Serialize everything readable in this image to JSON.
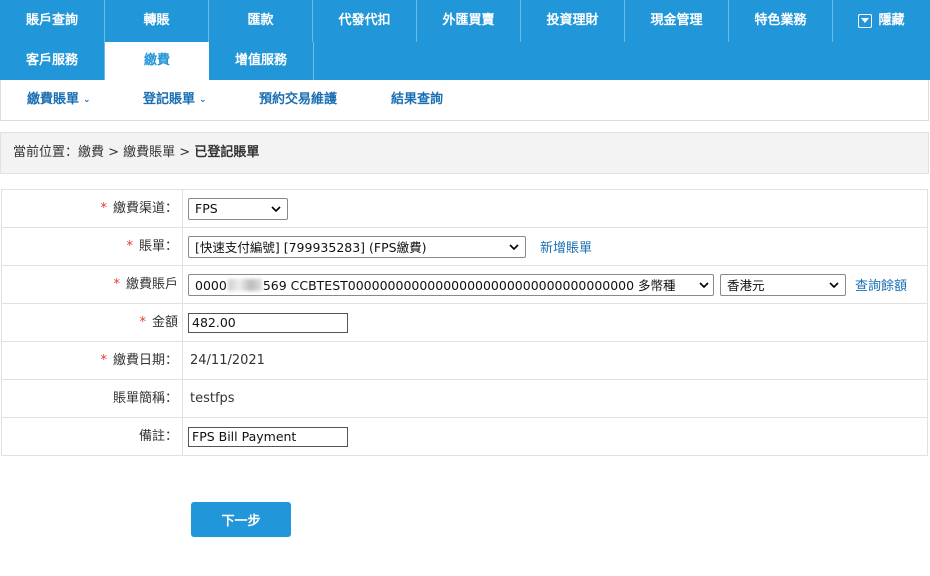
{
  "nav_primary": [
    "賬戶查詢",
    "轉賬",
    "匯款",
    "代發代扣",
    "外匯買賣",
    "投資理財",
    "現金管理",
    "特色業務"
  ],
  "nav_hide_label": "隱藏",
  "nav_secondary": [
    "客戶服務",
    "繳費",
    "增值服務"
  ],
  "nav_secondary_active": "繳費",
  "sub_nav": {
    "pay_bills": "繳費賬單",
    "register_bills": "登記賬單",
    "scheduled": "預約交易維護",
    "results": "結果查詢"
  },
  "breadcrumb": {
    "prefix": "當前位置：",
    "path": "繳費 > 繳費賬單 > ",
    "current": "已登記賬單"
  },
  "form": {
    "channel": {
      "label": "繳費渠道：",
      "value": "FPS"
    },
    "bill": {
      "label": "賬單：",
      "value": "[快速支付編號] [799935283] (FPS繳費)",
      "link": "新增賬單"
    },
    "account": {
      "label": "繳費賬戶",
      "value_prefix": "0000",
      "value_suffix": "569 CCBTEST000000000000000000000000000000000000 多幣種",
      "currency": "香港元",
      "link": "查詢餘額"
    },
    "amount": {
      "label": "金額",
      "value": "482.00"
    },
    "date": {
      "label": "繳費日期：",
      "value": "24/11/2021"
    },
    "nickname": {
      "label": "賬單簡稱：",
      "value": "testfps"
    },
    "remarks": {
      "label": "備註：",
      "value": "FPS Bill Payment"
    }
  },
  "next_button": "下一步",
  "colors": {
    "primary": "#2196d8",
    "link": "#1a6fb3",
    "required": "#e53935"
  }
}
